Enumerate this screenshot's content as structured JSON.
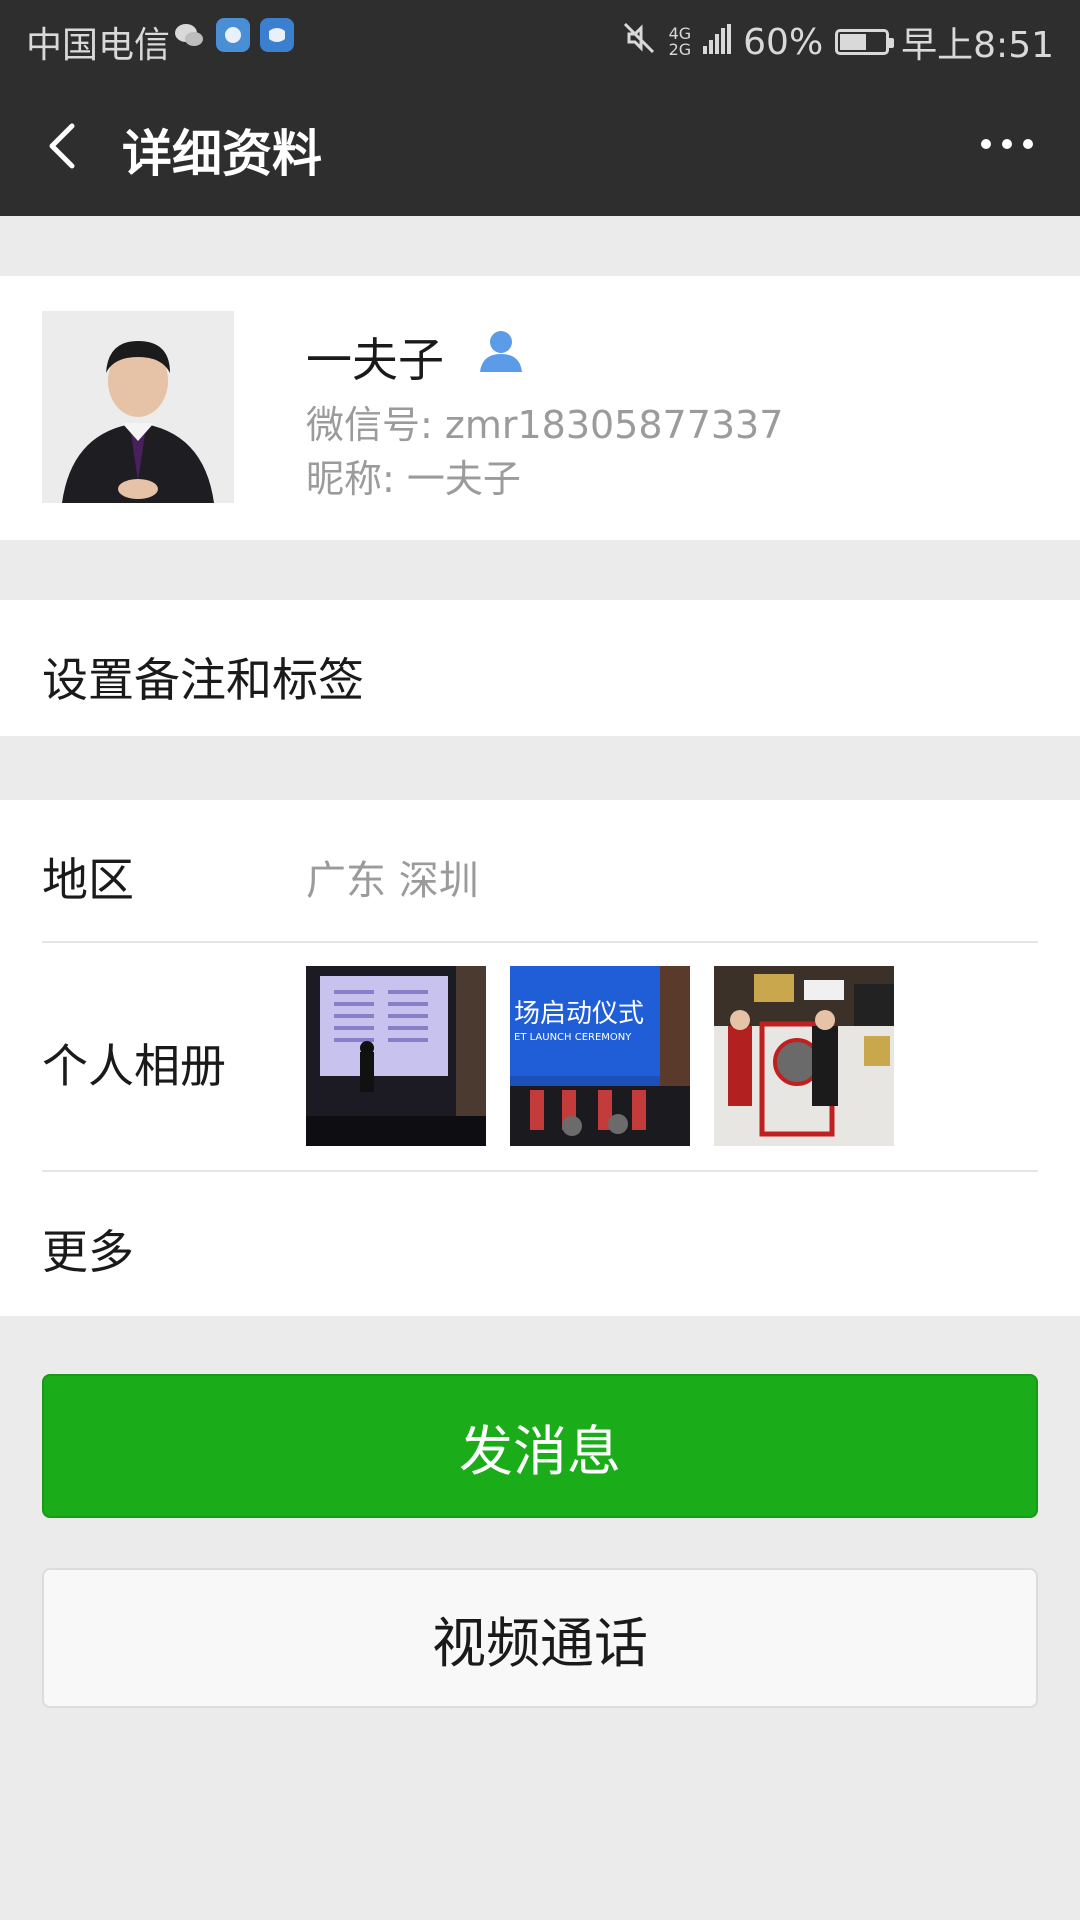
{
  "status_bar": {
    "carrier": "中国电信",
    "network_top": "4G",
    "network_bottom": "2G",
    "battery_percent": "60%",
    "battery_level": 0.6,
    "time": "早上8:51",
    "icons": [
      "wechat-icon",
      "app-icon",
      "app-icon",
      "mute-icon",
      "signal-icon",
      "battery-icon"
    ]
  },
  "header": {
    "title": "详细资料",
    "back_icon": "chevron-left-icon",
    "more_icon": "more-dots-icon"
  },
  "profile": {
    "name": "一夫子",
    "wechat_id": "微信号: zmr18305877337",
    "nickname": "昵称: 一夫子",
    "badge_icon": "person-icon"
  },
  "remark": {
    "label": "设置备注和标签"
  },
  "details": {
    "region_label": "地区",
    "region_value": "广东  深圳",
    "album_label": "个人相册",
    "album_thumbnails": [
      {
        "text": ""
      },
      {
        "text": "场启动仪式",
        "subtext": "ET LAUNCH CEREMONY"
      },
      {
        "text": ""
      }
    ],
    "more_label": "更多"
  },
  "actions": {
    "send_message": "发消息",
    "video_call": "视频通话"
  },
  "colors": {
    "header_bg": "#2e2e2e",
    "page_bg": "#ebebeb",
    "primary_green": "#1aad19",
    "secondary_text": "#9b9b9b",
    "person_icon_blue": "#5b9be8"
  }
}
